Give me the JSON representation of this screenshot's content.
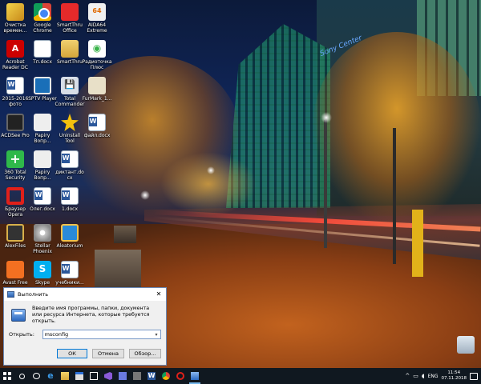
{
  "desktop": {
    "wallpaper_sign": "Sony Center",
    "icons": [
      {
        "label": "Очистка времен...",
        "icon": "cleanup-icon"
      },
      {
        "label": "Google Chrome",
        "icon": "chrome-icon"
      },
      {
        "label": "SmartThru Office",
        "icon": "smartthru-icon"
      },
      {
        "label": "AIDA64 Extreme",
        "icon": "aida64-icon"
      },
      {
        "label": "Acrobat Reader DC",
        "icon": "acrobat-icon"
      },
      {
        "label": "Тп.docx",
        "icon": "word-doc-icon"
      },
      {
        "label": "SmartThru",
        "icon": "smartthru-icon"
      },
      {
        "label": "Радиоточка Плюс",
        "icon": "radio-icon"
      },
      {
        "label": "2015-2016 фото",
        "icon": "word-doc-icon"
      },
      {
        "label": "SPTV Player",
        "icon": "gear-icon"
      },
      {
        "label": "Total Commander",
        "icon": "total-commander-icon"
      },
      {
        "label": "FurMark_1...",
        "icon": "furmark-icon"
      },
      {
        "label": "ACDSee Pro",
        "icon": "acdsee-icon"
      },
      {
        "label": "Papiry Вопр...",
        "icon": "papiry-icon"
      },
      {
        "label": "Uninstall Tool",
        "icon": "uninstall-tool-icon"
      },
      {
        "label": "файл.docx",
        "icon": "word-doc-icon"
      },
      {
        "label": "360 Total Security",
        "icon": "360-security-icon"
      },
      {
        "label": "Papiry Вопр...",
        "icon": "papiry-icon"
      },
      {
        "label": "диктант.docx",
        "icon": "word-doc-icon"
      },
      {
        "label": "",
        "icon": "empty"
      },
      {
        "label": "Браузер Opera",
        "icon": "opera-icon"
      },
      {
        "label": "Олег.docx",
        "icon": "word-doc-icon"
      },
      {
        "label": "1.docx",
        "icon": "word-doc-icon"
      },
      {
        "label": "",
        "icon": "empty"
      },
      {
        "label": "AlexFiles",
        "icon": "alex-icon"
      },
      {
        "label": "Stellar Phoenix",
        "icon": "disc-icon"
      },
      {
        "label": "Aleatorium",
        "icon": "aleatorium-icon"
      },
      {
        "label": "",
        "icon": "empty"
      },
      {
        "label": "Avast Free",
        "icon": "avast-icon"
      },
      {
        "label": "Skype",
        "icon": "skype-icon"
      },
      {
        "label": "учебники...",
        "icon": "word-doc-icon"
      },
      {
        "label": "",
        "icon": "empty"
      }
    ],
    "recycle_bin_label": ""
  },
  "run_dialog": {
    "title": "Выполнить",
    "close_glyph": "✕",
    "description": "Введите имя программы, папки, документа или ресурса Интернета, которые требуется открыть.",
    "open_label": "Открыть:",
    "open_value": "msconfig",
    "dropdown_glyph": "▾",
    "ok_label": "ОК",
    "cancel_label": "Отмена",
    "browse_label": "Обзор..."
  },
  "taskbar": {
    "pinned": [
      {
        "name": "tb-edge",
        "icon": "edge-icon"
      },
      {
        "name": "tb-explorer",
        "icon": "folder-icon"
      },
      {
        "name": "tb-store",
        "icon": "store-icon"
      },
      {
        "name": "tb-mail",
        "icon": "mail-icon"
      },
      {
        "name": "tb-visual-studio",
        "icon": "visual-studio-icon"
      },
      {
        "name": "tb-save",
        "icon": "save-icon"
      },
      {
        "name": "tb-calculator",
        "icon": "calculator-icon"
      },
      {
        "name": "tb-word",
        "icon": "word-icon"
      },
      {
        "name": "tb-chrome",
        "icon": "chrome-icon"
      },
      {
        "name": "tb-opera",
        "icon": "opera-icon"
      },
      {
        "name": "tb-run",
        "icon": "run-icon"
      }
    ],
    "edge_glyph": "e",
    "word_glyph": "W",
    "tray": {
      "chevron": "^",
      "network": "▭",
      "volume": "◖",
      "language": "ENG",
      "time": "11:54",
      "date": "07.11.2018"
    }
  },
  "colors": {
    "taskbar": "#101820",
    "dialog_bg": "#f0f0f0",
    "accent": "#0078d7"
  }
}
